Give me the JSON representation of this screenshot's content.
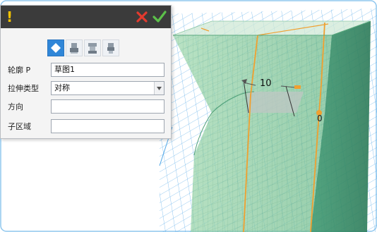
{
  "panel": {
    "warning_symbol": "!",
    "cancel_icon": "close-x-icon",
    "ok_icon": "checkmark-icon",
    "modes": [
      {
        "icon": "solid-diamond-icon",
        "active": true
      },
      {
        "icon": "extrude-add-icon",
        "active": false
      },
      {
        "icon": "extrude-subtract-icon",
        "active": false
      },
      {
        "icon": "extrude-intersect-icon",
        "active": false
      }
    ],
    "fields": {
      "profile": {
        "label": "轮廓 P",
        "value": "草图1"
      },
      "extrude_type": {
        "label": "拉伸类型",
        "value": "对称"
      },
      "direction": {
        "label": "方向",
        "value": ""
      },
      "sub_region": {
        "label": "子区域",
        "value": ""
      }
    }
  },
  "viewport": {
    "dimension_value": "10",
    "origin_label": "0"
  },
  "colors": {
    "panel_title": "#3b3b3b",
    "accent_blue": "#2f86d8",
    "cancel_red": "#e23a2e",
    "ok_green": "#5cc04a",
    "grid_blue": "#52a8e8",
    "solid_green": "#7fc99a",
    "edge_orange": "#f0a030"
  }
}
